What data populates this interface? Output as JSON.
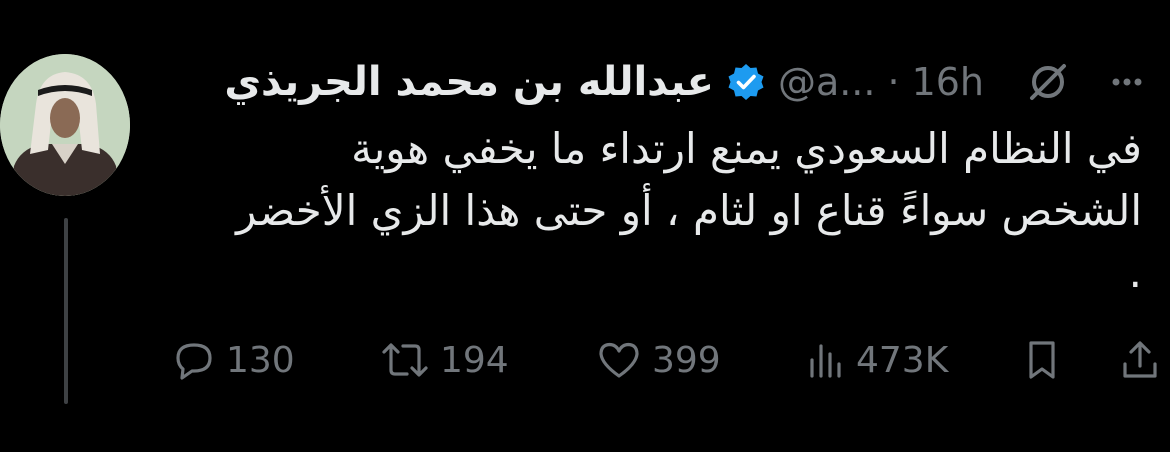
{
  "author": {
    "name": "عبدالله بن محمد الجريذي",
    "handle": "@a...",
    "separator": "·",
    "time": "16h",
    "verified": true
  },
  "tweet": {
    "lines": [
      "في النظام السعودي يمنع ارتداء ما يخفي هوية",
      "الشخص سواءً قناع او لثام ، أو حتى هذا الزي الأخضر",
      "."
    ]
  },
  "actions": {
    "replies": "130",
    "retweets": "194",
    "likes": "399",
    "views": "473K"
  },
  "colors": {
    "background": "#000000",
    "text": "#e7e9ea",
    "muted": "#71767b",
    "verified": "#1d9bf0"
  },
  "icons": {
    "reply": "reply-icon",
    "retweet": "retweet-icon",
    "like": "heart-icon",
    "views": "views-icon",
    "bookmark": "bookmark-icon",
    "share": "share-icon",
    "grok": "grok-icon",
    "more": "more-icon",
    "verified": "verified-badge-icon"
  }
}
